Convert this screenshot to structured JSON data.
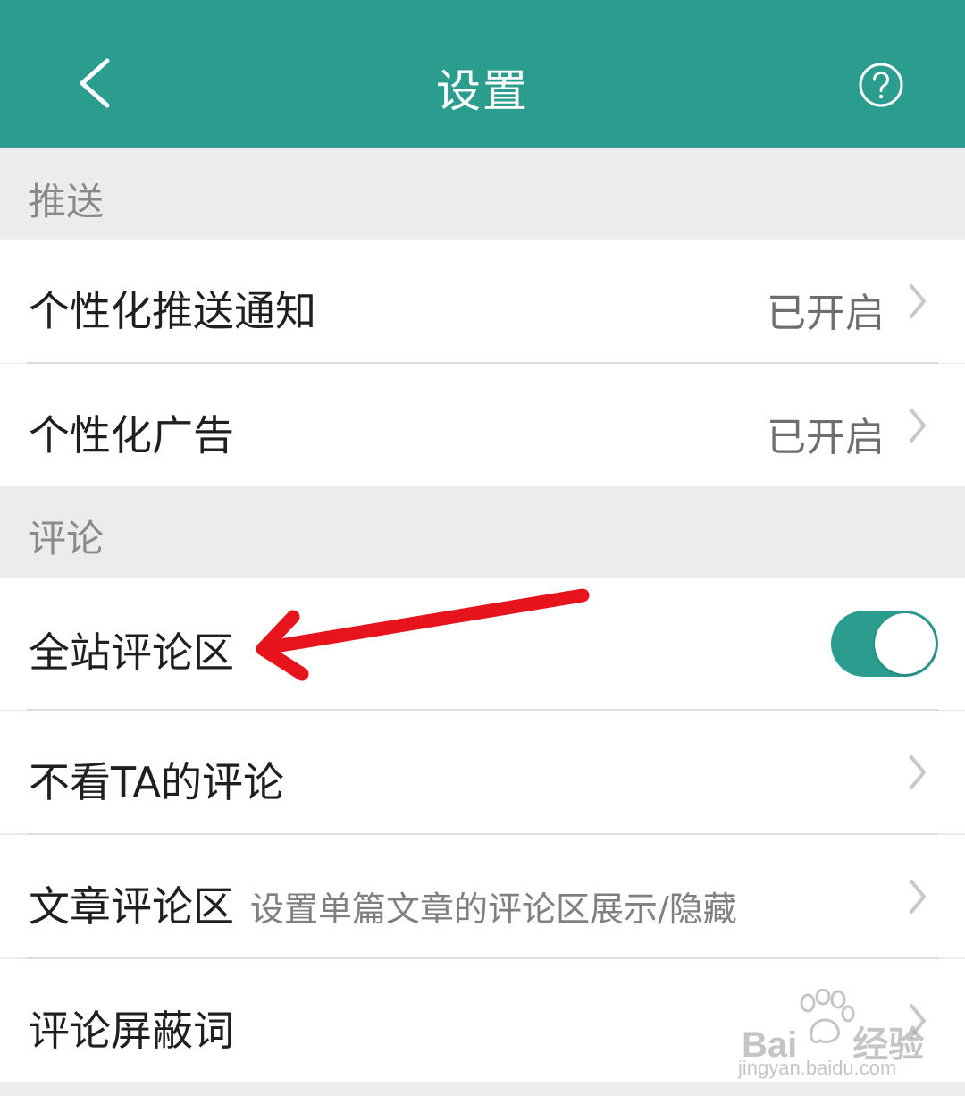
{
  "header": {
    "title": "设置",
    "back_icon": "chevron-left-icon",
    "help_icon": "help-circle-icon",
    "background": "#2a9d8f"
  },
  "sections": [
    {
      "title": "推送",
      "items": [
        {
          "label": "个性化推送通知",
          "value": "已开启"
        },
        {
          "label": "个性化广告",
          "value": "已开启"
        }
      ]
    },
    {
      "title": "评论",
      "items": [
        {
          "label": "全站评论区",
          "toggle_on": true
        },
        {
          "label": "不看TA的评论"
        },
        {
          "label": "文章评论区",
          "sublabel": "设置单篇文章的评论区展示/隐藏"
        },
        {
          "label": "评论屏蔽词"
        }
      ]
    }
  ],
  "annotation": {
    "color": "#e8141b",
    "icon": "red-arrow-annotation"
  },
  "watermark": {
    "brand": "Bai",
    "brand_suffix": "经验",
    "url": "jingyan.baidu.com"
  },
  "colors": {
    "accent": "#2a9d8f",
    "section_bg": "#ececec",
    "row_bg": "#ffffff"
  }
}
